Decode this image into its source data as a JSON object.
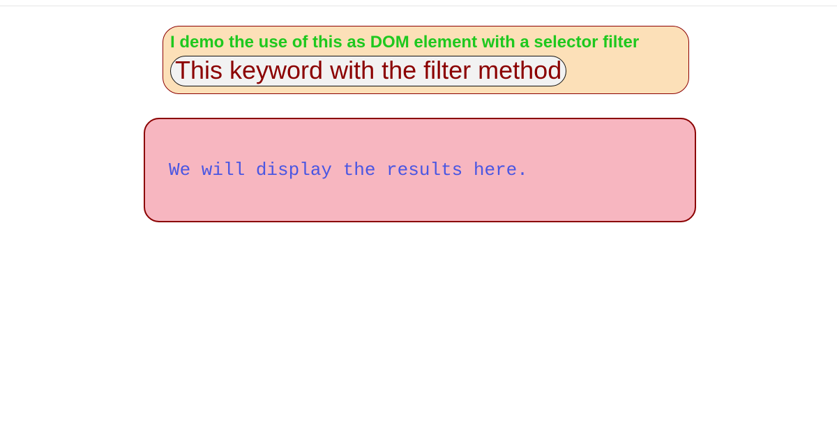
{
  "demo": {
    "heading": "I demo the use of this as DOM element with a selector filter",
    "pill_text": "This keyword with the filter method"
  },
  "results": {
    "text": "We will display the results here."
  }
}
